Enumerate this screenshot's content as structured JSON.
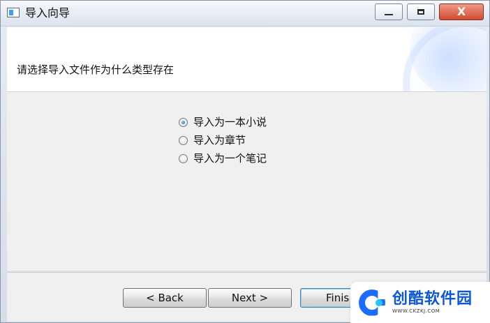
{
  "window": {
    "title": "导入向导",
    "controls": {
      "minimize_icon": "minimize-icon",
      "maximize_icon": "maximize-icon",
      "close_icon": "close-icon",
      "close_glyph": "X"
    }
  },
  "header": {
    "question": "请选择导入文件作为什么类型存在"
  },
  "options": [
    {
      "label": "导入为一本小说",
      "checked": true
    },
    {
      "label": "导入为章节",
      "checked": false
    },
    {
      "label": "导入为一个笔记",
      "checked": false
    }
  ],
  "buttons": {
    "back": "< Back",
    "next": "Next >",
    "finish": "Finis"
  },
  "watermark": {
    "name": "创酷软件园",
    "url": "WWW.CKZKJ.COM"
  },
  "colors": {
    "accent": "#1d6cff",
    "close_button": "#d24a31"
  }
}
